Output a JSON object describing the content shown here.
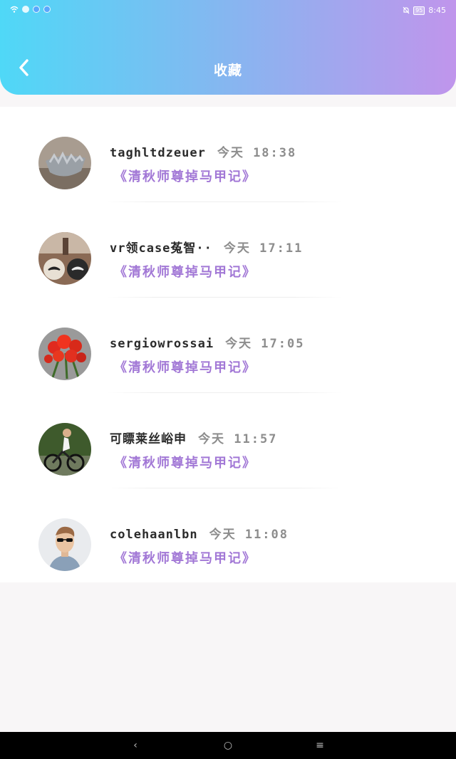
{
  "status_bar": {
    "time": "8:45",
    "battery": "95"
  },
  "header": {
    "title": "收藏",
    "back_icon": "chevron-left-icon"
  },
  "favorites": [
    {
      "username": "taghltdzeuer",
      "time": "今天  18:38",
      "book": "《清秋师尊掉马甲记》",
      "avatar": "bowl-photo"
    },
    {
      "username": "vr领case菟智··",
      "time": "今天  17:11",
      "book": "《清秋师尊掉马甲记》",
      "avatar": "mustache-photo"
    },
    {
      "username": "sergiowrossai",
      "time": "今天  17:05",
      "book": "《清秋师尊掉马甲记》",
      "avatar": "red-flowers-photo"
    },
    {
      "username": "可瞟莱丝峪申",
      "time": "今天  11:57",
      "book": "《清秋师尊掉马甲记》",
      "avatar": "cyclist-photo"
    },
    {
      "username": "colehaanlbn",
      "time": "今天  11:08",
      "book": "《清秋师尊掉马甲记》",
      "avatar": "man-sunglasses-photo"
    }
  ],
  "nav": {
    "back": "‹",
    "home": "○",
    "menu": "≡"
  },
  "colors": {
    "gradient_start": "#4fd8f7",
    "gradient_end": "#c095ec",
    "book_title": "#a278d6"
  }
}
